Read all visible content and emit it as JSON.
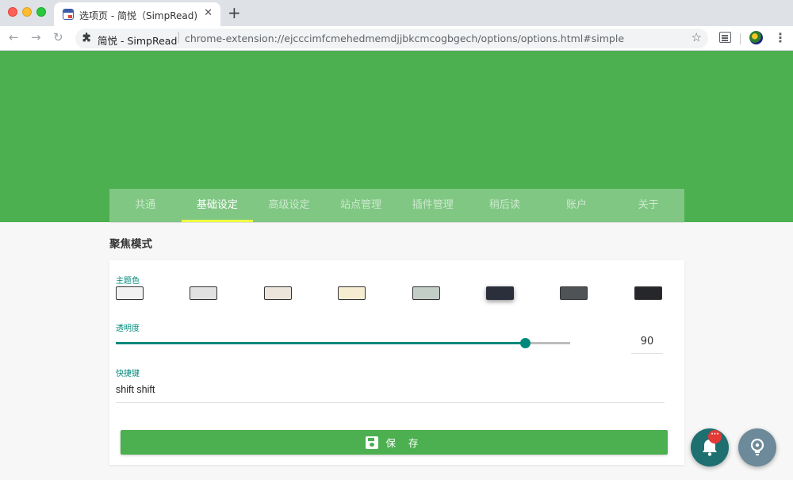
{
  "browser": {
    "tab_title": "选项页 - 简悦（SimpRead)",
    "tab_close": "✕",
    "new_tab": "+",
    "back": "←",
    "forward": "→",
    "reload": "↻",
    "site_name": "简悦 - SimpRead",
    "url_separator": "|",
    "url": "chrome-extension://ejcccimfcmehedmemdjjbkcmcogbgech/options/options.html#simple",
    "star": "☆",
    "menu": "⋮"
  },
  "nav": {
    "tabs": [
      {
        "label": "共通",
        "active": false
      },
      {
        "label": "基础设定",
        "active": true
      },
      {
        "label": "高级设定",
        "active": false
      },
      {
        "label": "站点管理",
        "active": false
      },
      {
        "label": "插件管理",
        "active": false
      },
      {
        "label": "稍后读",
        "active": false
      },
      {
        "label": "账户",
        "active": false
      },
      {
        "label": "关于",
        "active": false
      }
    ]
  },
  "main": {
    "section_title": "聚焦模式",
    "theme": {
      "label": "主题色",
      "swatches": [
        "#f2f2f2",
        "#e1e1e1",
        "#ebe5dc",
        "#f6ecd2",
        "#c3cec6",
        "#2b2f3b",
        "#4f5356",
        "#25272a"
      ],
      "selected_index": 5
    },
    "opacity": {
      "label": "透明度",
      "value": 90,
      "min": 0,
      "max": 100,
      "display": "90"
    },
    "shortcut": {
      "label": "快捷键",
      "value": "shift shift"
    },
    "save_label": "保 存"
  },
  "fab": {
    "notify_icon": "bell-icon",
    "badge_text": "···",
    "tip_icon": "bulb-icon"
  },
  "colors": {
    "primary": "#4caf50",
    "accent": "#00897b",
    "active_tab_indicator": "#eeff41",
    "badge": "#e53935"
  }
}
